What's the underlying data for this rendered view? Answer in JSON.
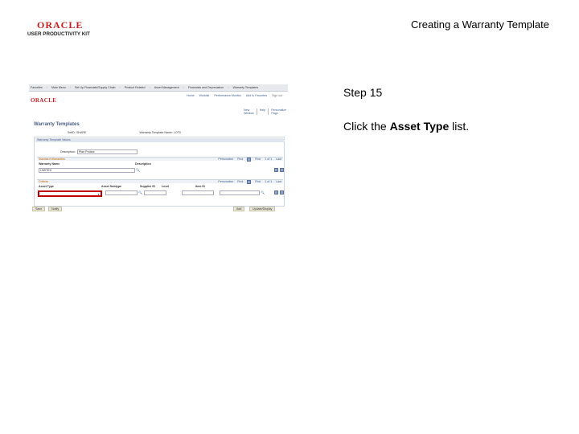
{
  "header": {
    "logo_oracle": "ORACLE",
    "logo_kit": "USER PRODUCTIVITY KIT",
    "doc_title": "Creating a Warranty Template"
  },
  "instructions": {
    "step": "Step 15",
    "text_before": "Click the ",
    "text_bold": "Asset Type",
    "text_after": " list."
  },
  "screenshot": {
    "nav": [
      "Favorites",
      "Main Menu",
      "Set Up Financials/Supply Chain",
      "Product Related",
      "Asset Management",
      "Financials and Depreciation",
      "Warranty Templates"
    ],
    "oracle": "ORACLE",
    "top_links": [
      "Home",
      "Worklist",
      "Performance Monitor",
      "Add to Favorites",
      "Sign out"
    ],
    "page_links": [
      "New Window",
      "Help",
      "Personalize Page"
    ],
    "page_title": "Warranty Templates",
    "setid_label": "SetID: SHARE",
    "template_name": "Warranty Template Name: LOT0",
    "section": "Warranty Template Values",
    "description_label": "Description:",
    "description_value": "Plan Protect",
    "grid1_title": "Standard Warranties",
    "grid1_pager": [
      "Personalize",
      "Find",
      "First",
      "1 of 1",
      "Last"
    ],
    "grid1_cols": [
      "Warranty Name",
      "Description"
    ],
    "grid1_value": "LIMITED",
    "grid2_title": "Criteria",
    "grid2_pager": [
      "Personalize",
      "Find",
      "First",
      "1 of 1",
      "Last"
    ],
    "grid2_cols": [
      "Asset Type",
      "Asset Subtype",
      "Supplier ID",
      "Level",
      "Item ID"
    ],
    "buttons": [
      "Save",
      "Notify",
      "Add",
      "Update/Display"
    ]
  }
}
